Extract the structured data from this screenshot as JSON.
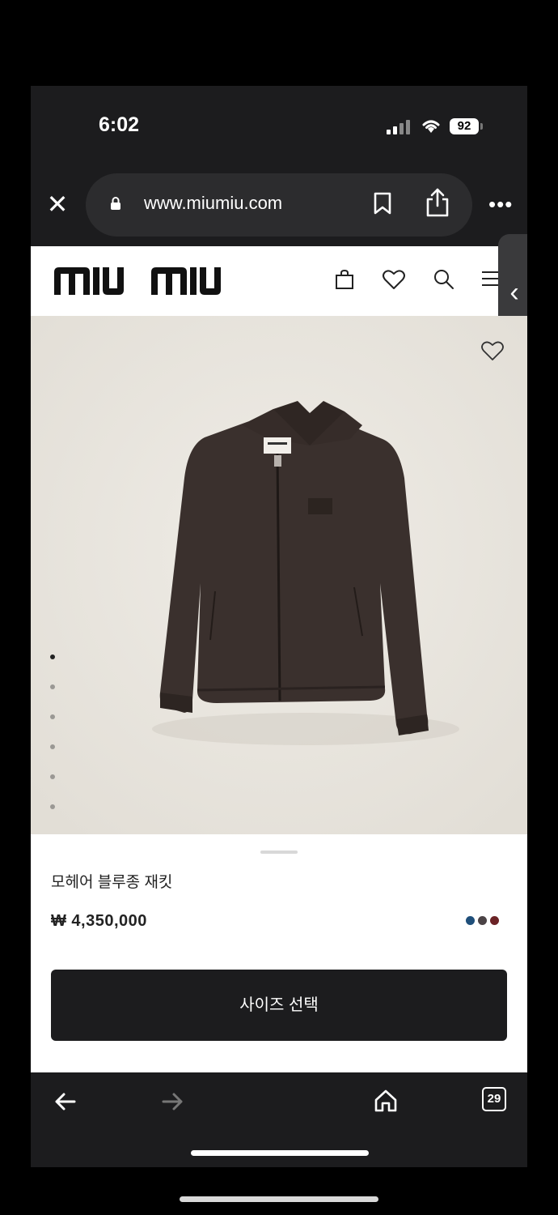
{
  "status_bar": {
    "time": "6:02",
    "battery": "92"
  },
  "browser": {
    "url": "www.miumiu.com",
    "tabs_count": "29"
  },
  "site": {
    "logo_text": "miu miu"
  },
  "product": {
    "name": "모헤어 블루종 재킷",
    "price": "₩ 4,350,000",
    "color_swatches": [
      "#1f4f7a",
      "#4b4346",
      "#6b2326"
    ],
    "image_count": 6,
    "active_image_index": 0,
    "cta_label": "사이즈 선택"
  },
  "colors": {
    "browser_chrome": "#1c1c1e",
    "url_pill": "#2c2c2e",
    "image_bg": "#e9e6df",
    "jacket": "#3a302d"
  }
}
